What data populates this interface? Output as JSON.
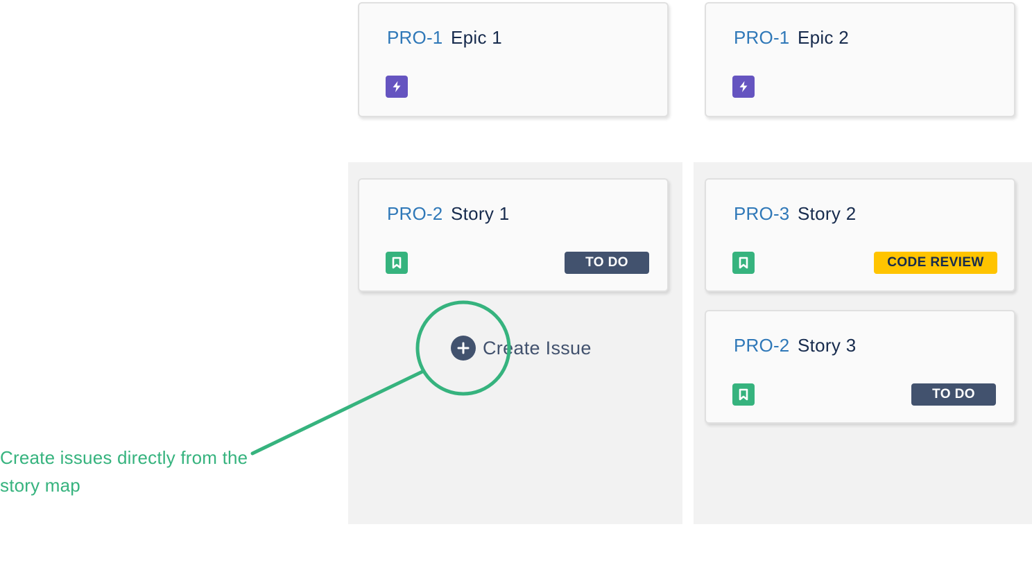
{
  "epics": [
    {
      "key": "PRO-1",
      "summary": "Epic 1",
      "icon": "epic-lightning-icon"
    },
    {
      "key": "PRO-1",
      "summary": "Epic 2",
      "icon": "epic-lightning-icon"
    }
  ],
  "stories": [
    {
      "key": "PRO-2",
      "summary": "Story 1",
      "icon": "story-bookmark-icon",
      "status": "TO DO"
    },
    {
      "key": "PRO-3",
      "summary": "Story 2",
      "icon": "story-bookmark-icon",
      "status": "CODE REVIEW"
    },
    {
      "key": "PRO-2",
      "summary": "Story 3",
      "icon": "story-bookmark-icon",
      "status": "TO DO"
    }
  ],
  "create_issue": {
    "label": "Create Issue",
    "icon": "plus-icon"
  },
  "annotation": {
    "text": "Create issues directly from the story map"
  },
  "colors": {
    "epic": "#6554c0",
    "story": "#36b37e",
    "todo": "#42526e",
    "code_review": "#ffc400",
    "annotation": "#36b37e",
    "issue_key": "#2f78b8"
  }
}
